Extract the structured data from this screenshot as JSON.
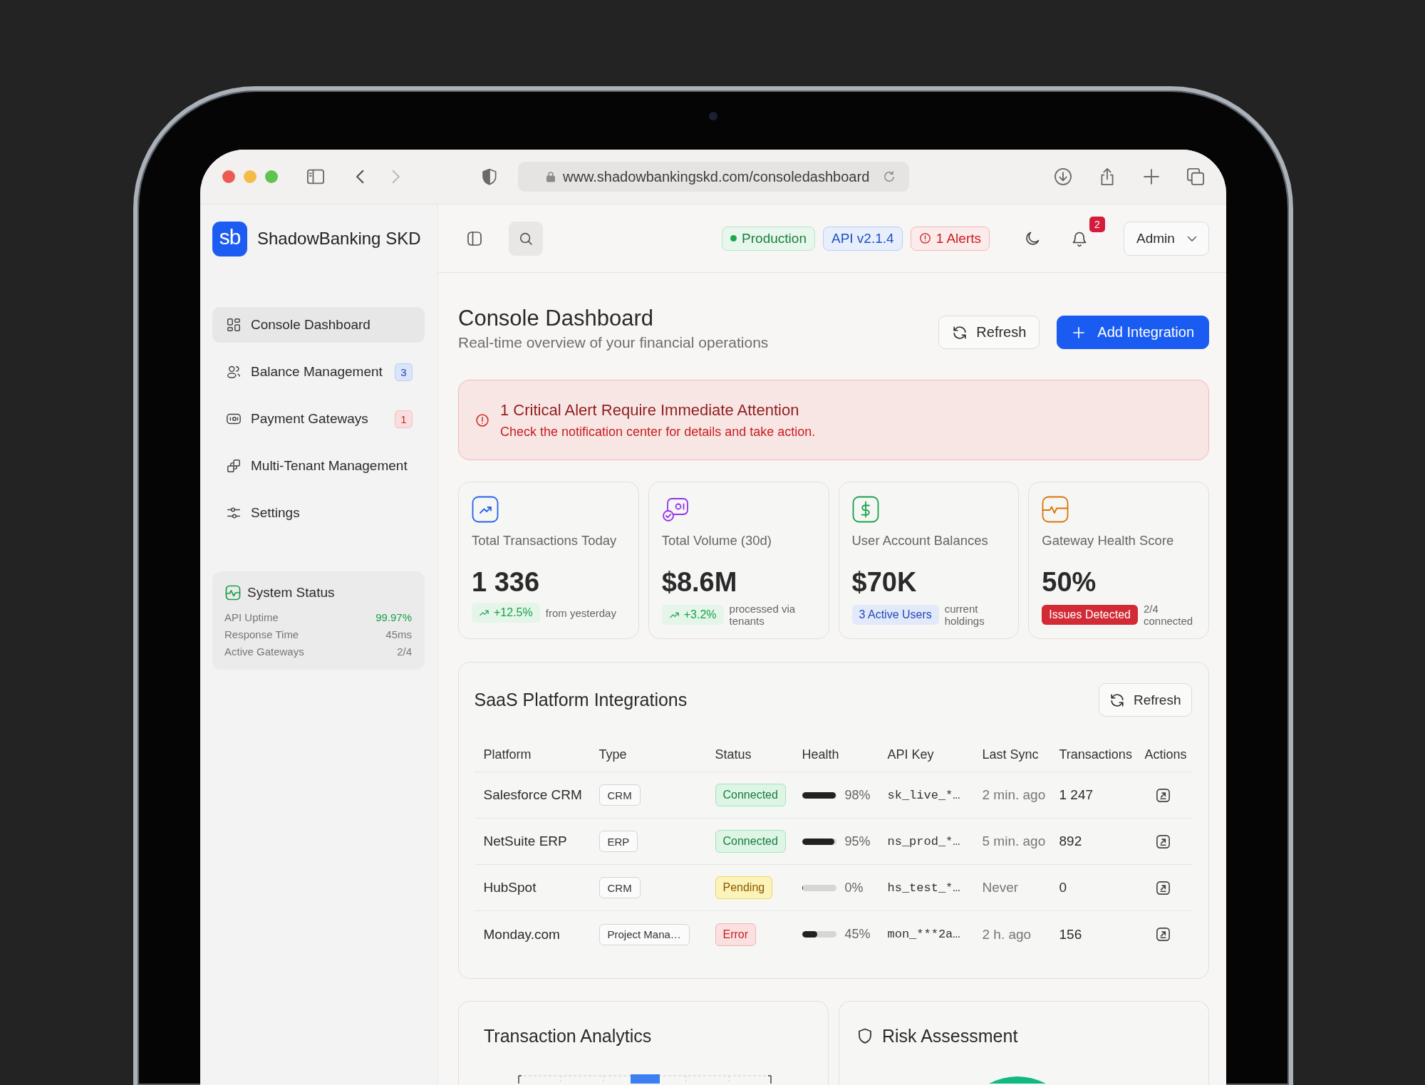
{
  "browser": {
    "url": "www.shadowbankingskd.com/consoledashboard",
    "nav": [
      {
        "kind": "back",
        "disabled": false
      },
      {
        "kind": "forward",
        "disabled": true
      }
    ]
  },
  "brand": {
    "mark": "sb",
    "name": "ShadowBanking SKD"
  },
  "sidebar": {
    "items": [
      {
        "label": "Console Dashboard",
        "selected": true
      },
      {
        "label": "Balance Management",
        "selected": false,
        "badge": {
          "text": "3",
          "kind": "info"
        }
      },
      {
        "label": "Payment Gateways",
        "selected": false,
        "badge": {
          "text": "1",
          "kind": "danger"
        }
      },
      {
        "label": "Multi-Tenant Management",
        "selected": false
      },
      {
        "label": "Settings",
        "selected": false
      }
    ],
    "system_status": {
      "title": "System Status",
      "rows": [
        {
          "label": "API Uptime",
          "value": "99.97%",
          "color": "#16a34a"
        },
        {
          "label": "Response Time",
          "value": "45ms",
          "color": "#777777"
        },
        {
          "label": "Active Gateways",
          "value": "2/4",
          "color": "#777777"
        }
      ]
    }
  },
  "header": {
    "tags": [
      {
        "kind": "status",
        "text": "Production"
      },
      {
        "kind": "version",
        "text": "API v2.1.4"
      },
      {
        "kind": "alert",
        "text": "1 Alerts"
      }
    ],
    "notifications": "2",
    "user": "Admin"
  },
  "page": {
    "title": "Console Dashboard",
    "subtitle": "Real-time overview of your financial operations",
    "buttons": [
      {
        "kind": "secondary",
        "label": "Refresh"
      },
      {
        "kind": "primary",
        "label": "Add Integration"
      }
    ]
  },
  "alert": {
    "title": "1 Critical Alert Require Immediate Attention",
    "message": "Check the notification center for details and take action."
  },
  "stats": [
    {
      "label": "Total Transactions Today",
      "value": "1 336",
      "color": "#2563eb",
      "chip": {
        "kind": "trend",
        "text": "+12.5%"
      },
      "note": "from yesterday"
    },
    {
      "label": "Total Volume (30d)",
      "value": "$8.6M",
      "color": "#9333ea",
      "chip": {
        "kind": "trend",
        "text": "+3.2%"
      },
      "note": "processed via tenants"
    },
    {
      "label": "User Account Balances",
      "value": "$70K",
      "color": "#16a34a",
      "chip": {
        "kind": "info",
        "text": "3 Active Users"
      },
      "note": "current holdings"
    },
    {
      "label": "Gateway Health Score",
      "value": "50%",
      "color": "#d97706",
      "chip": {
        "kind": "danger",
        "text": "Issues Detected"
      },
      "note": "2/4 connected"
    }
  ],
  "integrations": {
    "title": "SaaS Platform Integrations",
    "refresh": "Refresh",
    "columns": [
      "Platform",
      "Type",
      "Status",
      "Health",
      "API Key",
      "Last Sync",
      "Transactions",
      "Actions"
    ],
    "rows": [
      {
        "platform": "Salesforce CRM",
        "type": "CRM",
        "status": {
          "kind": "connected",
          "text": "Connected"
        },
        "health": {
          "level": 0.98,
          "reading": "98%"
        },
        "api_key": "sk_live_*…",
        "last_sync": "2 min. ago",
        "transactions": "1 247"
      },
      {
        "platform": "NetSuite ERP",
        "type": "ERP",
        "status": {
          "kind": "connected",
          "text": "Connected"
        },
        "health": {
          "level": 0.95,
          "reading": "95%"
        },
        "api_key": "ns_prod_*…",
        "last_sync": "5 min. ago",
        "transactions": "892"
      },
      {
        "platform": "HubSpot",
        "type": "CRM",
        "status": {
          "kind": "pending",
          "text": "Pending"
        },
        "health": {
          "level": 0,
          "reading": "0%"
        },
        "api_key": "hs_test_*…",
        "last_sync": "Never",
        "transactions": "0"
      },
      {
        "platform": "Monday.com",
        "type": "Project Mana…",
        "status": {
          "kind": "error",
          "text": "Error"
        },
        "health": {
          "level": 0.45,
          "reading": "45%"
        },
        "api_key": "mon_***2a…",
        "last_sync": "2 h. ago",
        "transactions": "156"
      }
    ]
  },
  "panels": [
    {
      "kind": "bar-chart",
      "title": "Transaction Analytics"
    },
    {
      "kind": "gauge",
      "title": "Risk Assessment"
    }
  ]
}
